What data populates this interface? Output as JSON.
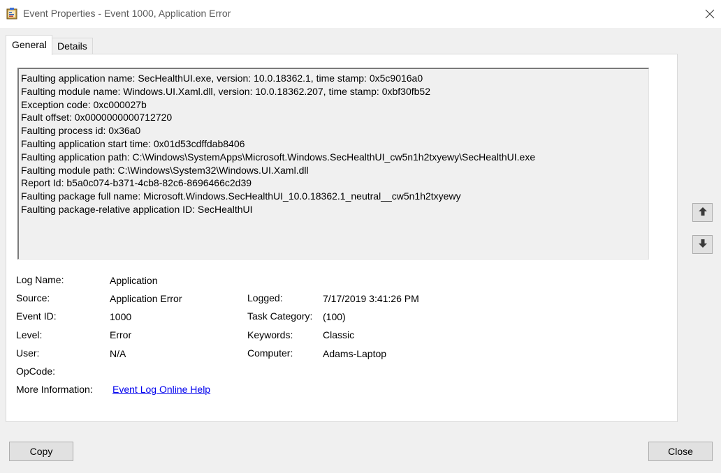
{
  "window": {
    "title": "Event Properties - Event 1000, Application Error",
    "app_icon": "event-viewer-icon",
    "close_icon": "close-icon"
  },
  "tabs": [
    {
      "label": "General",
      "active": true
    },
    {
      "label": "Details",
      "active": false
    }
  ],
  "description": {
    "lines": [
      "Faulting application name: SecHealthUI.exe, version: 10.0.18362.1, time stamp: 0x5c9016a0",
      "Faulting module name: Windows.UI.Xaml.dll, version: 10.0.18362.207, time stamp: 0xbf30fb52",
      "Exception code: 0xc000027b",
      "Fault offset: 0x0000000000712720",
      "Faulting process id: 0x36a0",
      "Faulting application start time: 0x01d53cdffdab8406",
      "Faulting application path: C:\\Windows\\SystemApps\\Microsoft.Windows.SecHealthUI_cw5n1h2txyewy\\SecHealthUI.exe",
      "Faulting module path: C:\\Windows\\System32\\Windows.UI.Xaml.dll",
      "Report Id: b5a0c074-b371-4cb8-82c6-8696466c2d39",
      "Faulting package full name: Microsoft.Windows.SecHealthUI_10.0.18362.1_neutral__cw5n1h2txyewy",
      "Faulting package-relative application ID: SecHealthUI"
    ]
  },
  "fields": {
    "log_name": {
      "label": "Log Name:",
      "value": "Application"
    },
    "source": {
      "label": "Source:",
      "value": "Application Error"
    },
    "logged": {
      "label": "Logged:",
      "value": "7/17/2019 3:41:26 PM"
    },
    "event_id": {
      "label": "Event ID:",
      "value": "1000"
    },
    "task_category": {
      "label": "Task Category:",
      "value": "(100)"
    },
    "level": {
      "label": "Level:",
      "value": "Error"
    },
    "keywords": {
      "label": "Keywords:",
      "value": "Classic"
    },
    "user": {
      "label": "User:",
      "value": "N/A"
    },
    "computer": {
      "label": "Computer:",
      "value": "Adams-Laptop"
    },
    "opcode": {
      "label": "OpCode:",
      "value": ""
    },
    "more_info": {
      "label": "More Information:",
      "link": "Event Log Online Help"
    }
  },
  "nav": {
    "up_icon": "arrow-up-icon",
    "down_icon": "arrow-down-icon"
  },
  "buttons": {
    "copy": "Copy",
    "close": "Close"
  }
}
